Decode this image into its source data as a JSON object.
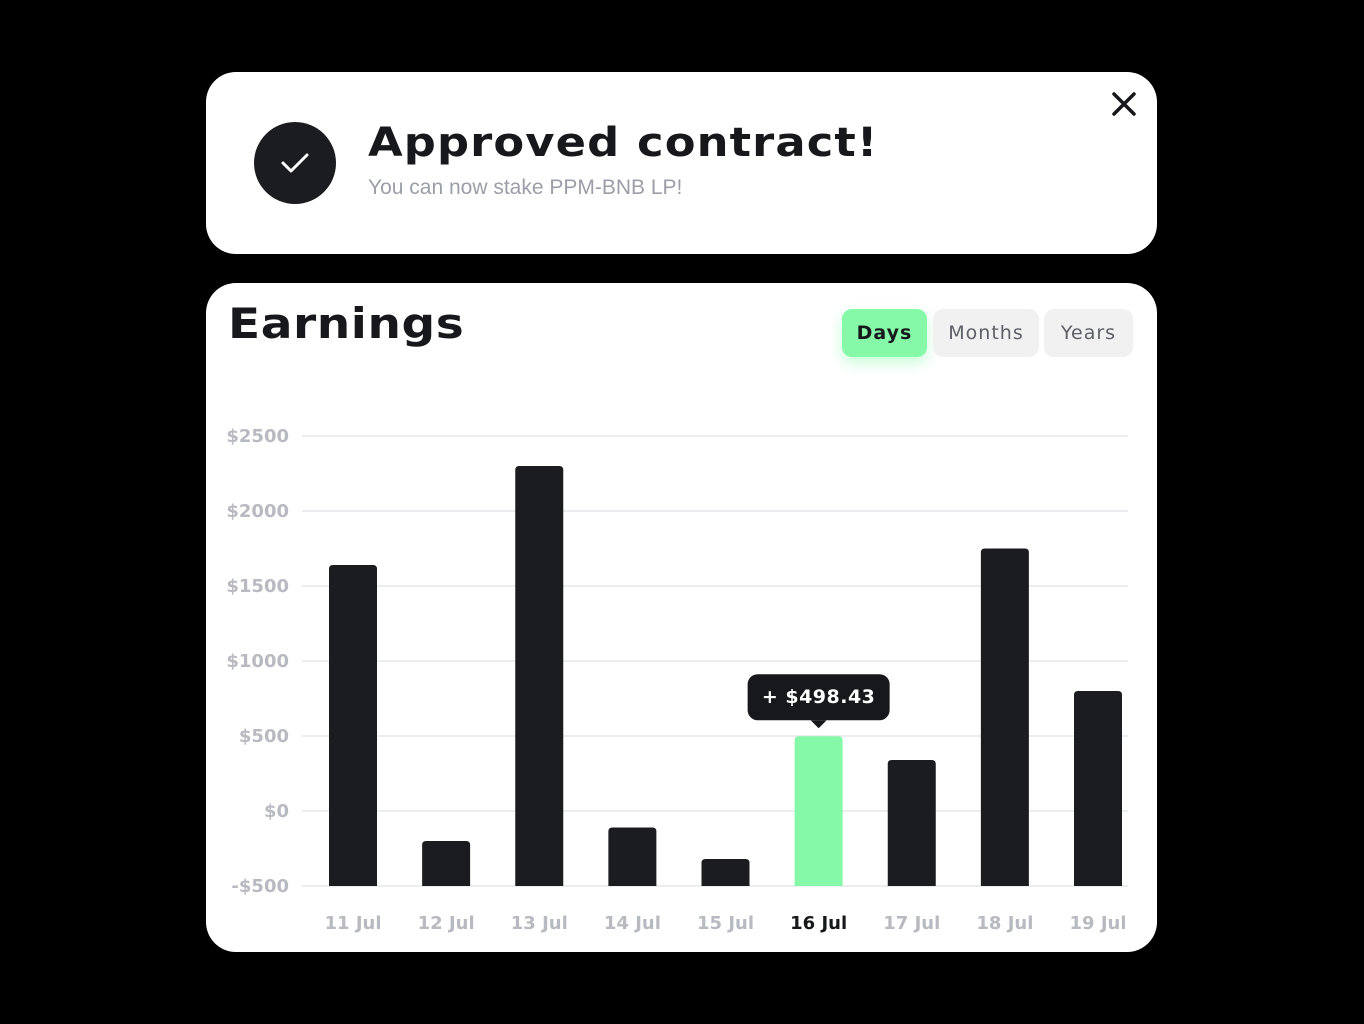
{
  "notification": {
    "title": "Approved contract!",
    "subtitle": "You can now stake PPM-BNB LP!",
    "icon": "check-icon",
    "close_icon": "close-icon"
  },
  "earnings": {
    "title": "Earnings",
    "tabs": [
      {
        "label": "Days",
        "active": true
      },
      {
        "label": "Months",
        "active": false
      },
      {
        "label": "Years",
        "active": false
      }
    ]
  },
  "colors": {
    "bar": "#1b1c1f",
    "highlight": "#86f9a9",
    "axis_text": "#b8bac1",
    "grid": "#e6e7ea"
  },
  "chart_data": {
    "type": "bar",
    "title": "Earnings",
    "categories": [
      "11 Jul",
      "12 Jul",
      "13 Jul",
      "14 Jul",
      "15 Jul",
      "16 Jul",
      "17 Jul",
      "18 Jul",
      "19 Jul"
    ],
    "values": [
      1640,
      -200,
      2300,
      -110,
      -320,
      498.43,
      340,
      1750,
      800
    ],
    "ylim": [
      -500,
      2500
    ],
    "yticks": [
      -500,
      0,
      500,
      1000,
      1500,
      2000,
      2500
    ],
    "ytick_labels": [
      "-$500",
      "$0",
      "$500",
      "$1000",
      "$1500",
      "$2000",
      "$2500"
    ],
    "grid": true,
    "highlight_index": 5,
    "tooltip": "+ $498.43"
  }
}
